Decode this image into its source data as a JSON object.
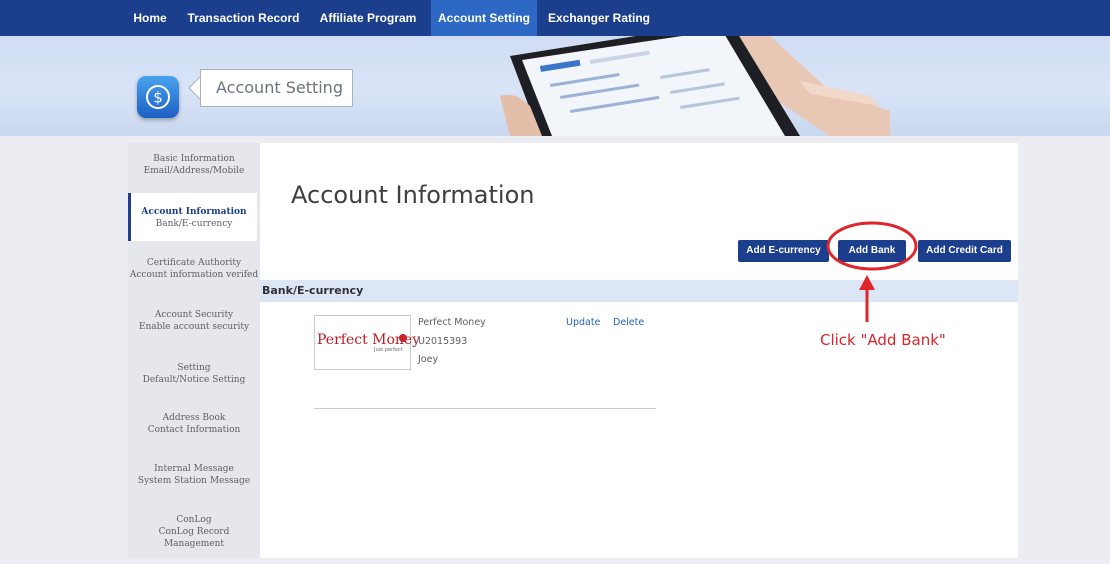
{
  "nav": {
    "items": [
      {
        "label": "Home"
      },
      {
        "label": "Transaction Record"
      },
      {
        "label": "Affiliate Program"
      },
      {
        "label": "Account Setting",
        "active": true
      },
      {
        "label": "Exchanger Rating"
      }
    ]
  },
  "banner": {
    "icon": "dollar-coin-icon",
    "title": "Account Setting"
  },
  "sidebar": {
    "items": [
      {
        "title": "Basic Information",
        "sub": "Email/Address/Mobile"
      },
      {
        "title": "Account Information",
        "sub": "Bank/E-currency",
        "active": true
      },
      {
        "title": "Certificate Authority",
        "sub": "Account information verifed"
      },
      {
        "title": "Account Security",
        "sub": "Enable account security"
      },
      {
        "title": "Setting",
        "sub": "Default/Notice Setting"
      },
      {
        "title": "Address Book",
        "sub": "Contact Information"
      },
      {
        "title": "Internal Message",
        "sub": "System Station Message"
      },
      {
        "title": "ConLog",
        "sub": "ConLog Record Management"
      }
    ]
  },
  "main": {
    "title": "Account Information",
    "buttons": {
      "add_ecurrency": "Add E-currency",
      "add_bank": "Add Bank",
      "add_credit_card": "Add Credit Card"
    },
    "section": "Bank/E-currency",
    "account": {
      "logo_text": "Perfect Money",
      "logo_tagline": "Just perfect",
      "name": "Perfect Money",
      "number": "U2015393",
      "holder": "Joey",
      "update_label": "Update",
      "delete_label": "Delete"
    }
  },
  "annotation": {
    "text": "Click \"Add Bank\"",
    "color": "#d8262a"
  },
  "colors": {
    "nav": "#1b3e8d",
    "nav_active": "#2c68c4",
    "button": "#1b3e8d",
    "link": "#2562c4"
  }
}
